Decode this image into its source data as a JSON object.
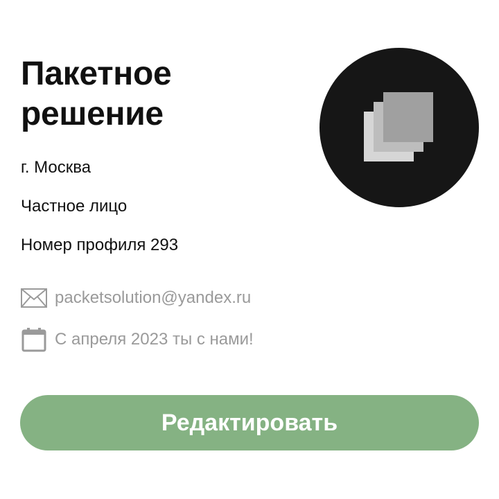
{
  "profile": {
    "title_line1": "Пакетное",
    "title_line2": "решение",
    "city": "г. Москва",
    "account_type": "Частное лицо",
    "profile_number": "Номер профиля 293",
    "email": "packetsolution@yandex.ru",
    "member_since": "С апреля 2023 ты с нами!"
  },
  "icons": {
    "email": "envelope-icon",
    "calendar": "calendar-icon",
    "avatar": "stacked-squares-logo"
  },
  "actions": {
    "edit_label": "Редактировать"
  },
  "colors": {
    "accent": "#85b283",
    "text_primary": "#111111",
    "text_secondary": "#9a9a9a",
    "avatar_bg": "#161616"
  }
}
